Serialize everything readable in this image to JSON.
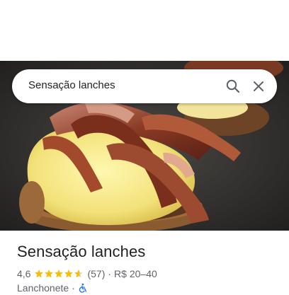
{
  "search": {
    "query": "Sensação lanches"
  },
  "place": {
    "title": "Sensação lanches",
    "rating": "4,6",
    "rating_value": 4.6,
    "review_count": "(57)",
    "separator": "·",
    "price_range": "R$ 20–40",
    "category": "Lanchonete",
    "category_separator": "·",
    "accessibility_icon": "wheelchair-icon"
  },
  "colors": {
    "star": "#FBBC04",
    "star_empty": "#dadce0",
    "text_primary": "#202124",
    "text_secondary": "#5f6368",
    "accessibility_icon": "#1a73e8"
  }
}
